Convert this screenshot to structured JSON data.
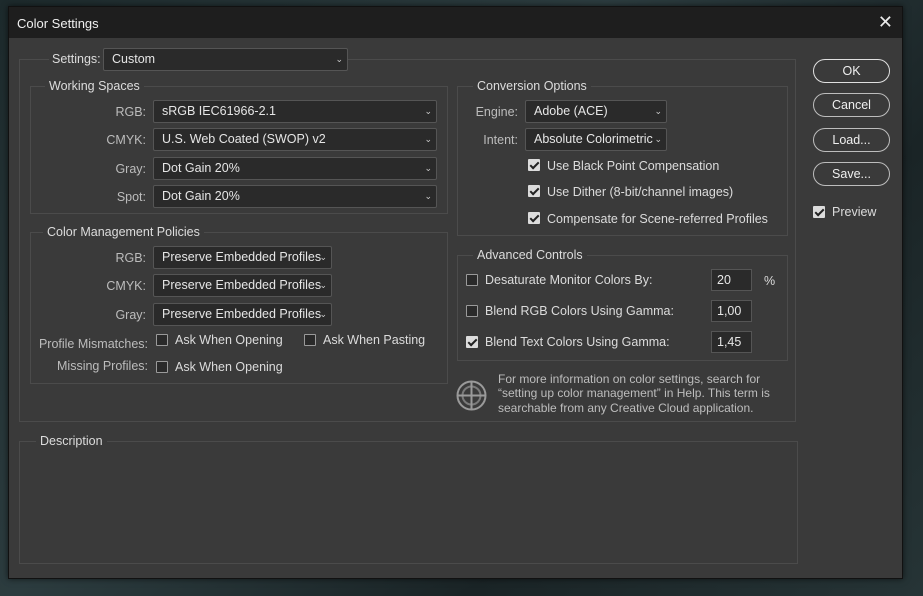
{
  "dialog": {
    "title": "Color Settings"
  },
  "settings": {
    "label": "Settings:",
    "value": "Custom"
  },
  "working_spaces": {
    "title": "Working Spaces",
    "rows": [
      {
        "label": "RGB:",
        "value": "sRGB IEC61966-2.1"
      },
      {
        "label": "CMYK:",
        "value": "U.S. Web Coated (SWOP) v2"
      },
      {
        "label": "Gray:",
        "value": "Dot Gain 20%"
      },
      {
        "label": "Spot:",
        "value": "Dot Gain 20%"
      }
    ]
  },
  "policies": {
    "title": "Color Management Policies",
    "rows": [
      {
        "label": "RGB:",
        "value": "Preserve Embedded Profiles"
      },
      {
        "label": "CMYK:",
        "value": "Preserve Embedded Profiles"
      },
      {
        "label": "Gray:",
        "value": "Preserve Embedded Profiles"
      }
    ],
    "mismatches_label": "Profile Mismatches:",
    "ask_opening": "Ask When Opening",
    "ask_pasting": "Ask When Pasting",
    "missing_label": "Missing Profiles:",
    "missing_ask_opening": "Ask When Opening"
  },
  "conversion": {
    "title": "Conversion Options",
    "engine_label": "Engine:",
    "engine_value": "Adobe (ACE)",
    "intent_label": "Intent:",
    "intent_value": "Absolute Colorimetric",
    "checks": [
      {
        "label": "Use Black Point Compensation",
        "checked": true
      },
      {
        "label": "Use Dither (8-bit/channel images)",
        "checked": true
      },
      {
        "label": "Compensate for Scene-referred Profiles",
        "checked": true
      }
    ]
  },
  "advanced": {
    "title": "Advanced Controls",
    "rows": [
      {
        "label": "Desaturate Monitor Colors By:",
        "value": "20",
        "unit": "%",
        "checked": false
      },
      {
        "label": "Blend RGB Colors Using Gamma:",
        "value": "1,00",
        "checked": false
      },
      {
        "label": "Blend Text Colors Using Gamma:",
        "value": "1,45",
        "checked": true
      }
    ]
  },
  "info": {
    "line1": "For more information on color settings, search for",
    "line2": "“setting up color management” in Help. This term is",
    "line3": "searchable from any Creative Cloud application."
  },
  "description": {
    "title": "Description"
  },
  "buttons": {
    "ok": "OK",
    "cancel": "Cancel",
    "load": "Load...",
    "save": "Save..."
  },
  "preview": {
    "label": "Preview",
    "checked": true
  }
}
